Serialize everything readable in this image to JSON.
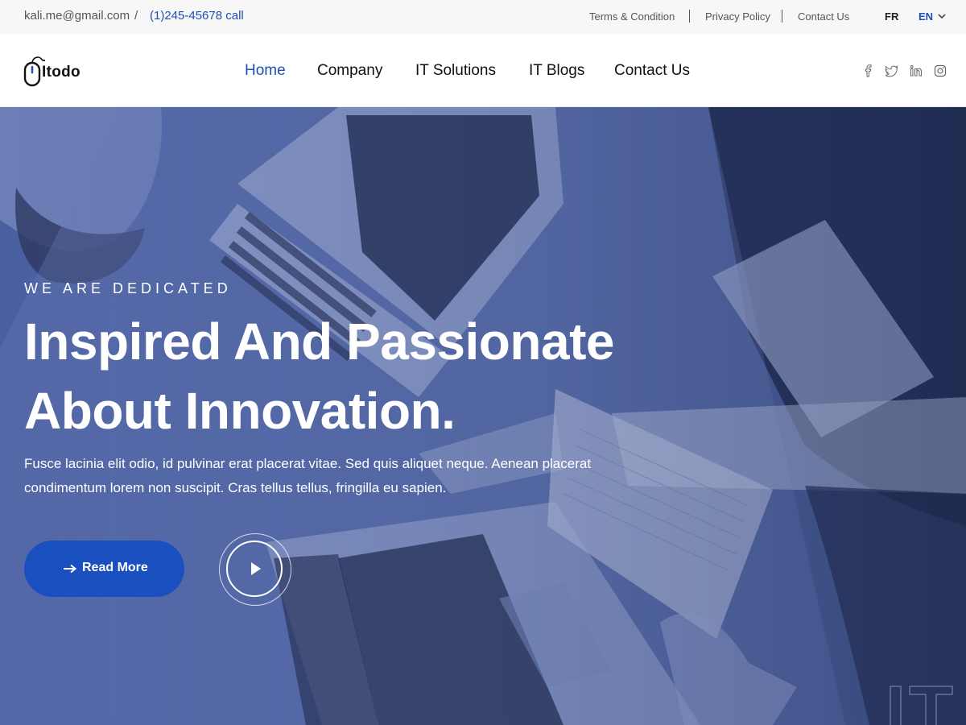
{
  "topbar": {
    "email": "kali.me@gmail.com",
    "separator": "/",
    "phone": "(1)245-45678 call",
    "links": [
      "Terms & Condition",
      "Privacy Policy",
      "Contact Us"
    ],
    "languages": [
      {
        "code": "FR",
        "active": false
      },
      {
        "code": "EN",
        "active": true
      }
    ]
  },
  "header": {
    "logo_text": "Itodo",
    "nav": [
      {
        "label": "Home",
        "active": true
      },
      {
        "label": "Company",
        "active": false
      },
      {
        "label": "IT Solutions",
        "active": false
      },
      {
        "label": "IT Blogs",
        "active": false
      },
      {
        "label": "Contact Us",
        "active": false
      }
    ],
    "social_icons": [
      "facebook-icon",
      "twitter-icon",
      "linkedin-icon",
      "instagram-icon"
    ]
  },
  "hero": {
    "eyebrow": "WE ARE DEDICATED",
    "headline_line1": "Inspired And Passionate",
    "headline_line2": "About Innovation.",
    "description_line1": "Fusce lacinia elit odio, id pulvinar erat placerat vitae. Sed quis aliquet neque. Aenean placerat",
    "description_line2": "condimentum lorem non suscipit. Cras tellus tellus, fringilla eu sapien.",
    "button_label": "Read More",
    "watermark": "IT"
  },
  "colors": {
    "accent": "#1e4fb5",
    "button": "#1a4fc0",
    "hero_overlay": "#5a70b0",
    "topbar_bg": "#f7f7f7"
  }
}
